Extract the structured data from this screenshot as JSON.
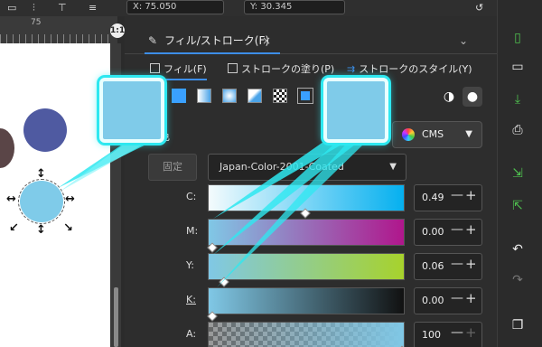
{
  "topbar": {
    "x_label": "X:",
    "x_value": "75.050",
    "y_label": "Y:",
    "y_value": "30.345"
  },
  "ruler": {
    "tick_label": "75"
  },
  "zoom_badge": "1:1",
  "dock": {
    "tab_label": "フィル/ストローク(F)",
    "close": "×",
    "collapse": "⌄"
  },
  "subtabs": [
    {
      "label": "フィル(F)",
      "active": true
    },
    {
      "label": "ストロークの塗り(P)",
      "active": false
    },
    {
      "label": "ストロークのスタイル(Y)",
      "active": false
    }
  ],
  "fill_rules": {
    "evenodd": "◑",
    "nonzero": "●"
  },
  "color": {
    "label": "色",
    "mode_label": "CMS",
    "fixed_label": "固定",
    "profile_value": "Japan-Color-2001-Coated",
    "current_hex": "#7fcbe9"
  },
  "channels": [
    {
      "label": "C:",
      "value": "0.49",
      "gradient": [
        "#f4fbfd",
        "#05b0ef"
      ],
      "pos": 0.49
    },
    {
      "label": "M:",
      "value": "0.00",
      "gradient": [
        "#80c8e6",
        "#b0168c"
      ],
      "pos": 0.0
    },
    {
      "label": "Y:",
      "value": "0.06",
      "gradient": [
        "#80c8e6",
        "#a7d22c"
      ],
      "pos": 0.06
    },
    {
      "label": "K:",
      "value": "0.00",
      "gradient": [
        "#80c8e6",
        "#111111"
      ],
      "pos": 0.0,
      "underline": true
    },
    {
      "label": "A:",
      "value": "100",
      "gradient": [
        "#ffffff00",
        "#80c8e6"
      ],
      "pos": 1.0
    }
  ],
  "stepper": {
    "minus": "—",
    "plus": "+"
  },
  "canvas_colors": {
    "blue_circle": "#4f5aa1",
    "brown_circle": "#5a4547",
    "selected_circle": "#7fcbe9"
  },
  "right_toolbar_icons": [
    "new-document-icon",
    "open-icon",
    "save-icon",
    "print-icon",
    "import-icon",
    "export-icon",
    "undo-icon",
    "redo-icon",
    "copy-icon"
  ]
}
